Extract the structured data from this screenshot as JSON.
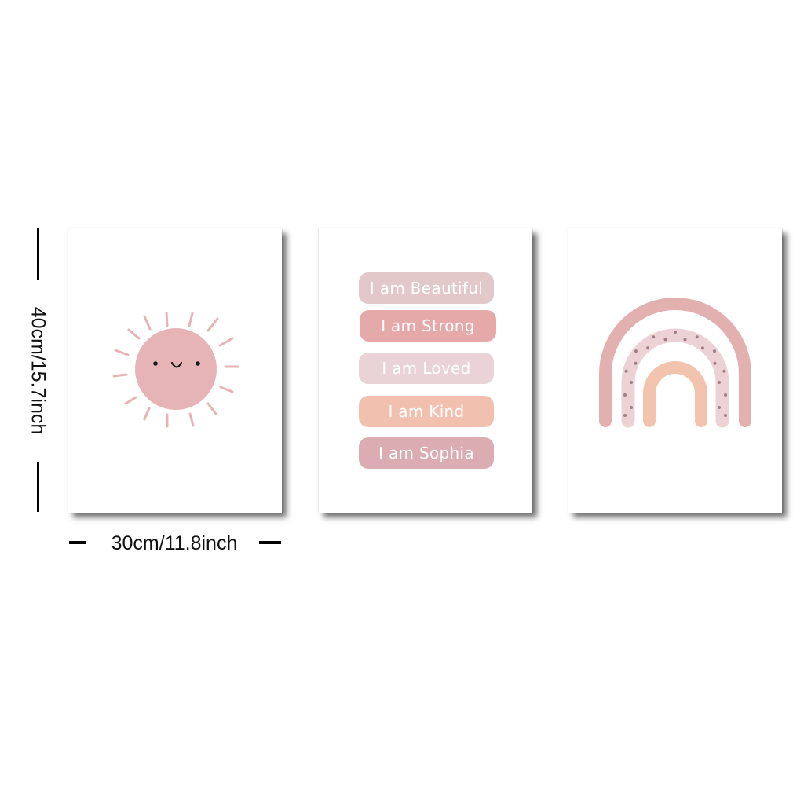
{
  "dimensions": {
    "height_label": "40cm/15.7inch",
    "width_label": "30cm/11.8inch"
  },
  "posters": {
    "sun": {
      "icon": "smiling-sun-icon",
      "color": "#e6b4b6"
    },
    "affirmations": {
      "items": [
        {
          "text": "I am Beautiful",
          "color": "#e3c8ca"
        },
        {
          "text": "I am Strong",
          "color": "#e6a9a9"
        },
        {
          "text": "I am Loved",
          "color": "#ead3d6"
        },
        {
          "text": "I am Kind",
          "color": "#f2c0ae"
        },
        {
          "text": "I am Sophia",
          "color": "#dbacb2"
        }
      ]
    },
    "rainbow": {
      "icon": "rainbow-icon",
      "colors": {
        "outer": "#e3b0b0",
        "middle": "#ecd2d4",
        "inner": "#f2c4ad",
        "dots": "#a07f86"
      }
    }
  }
}
